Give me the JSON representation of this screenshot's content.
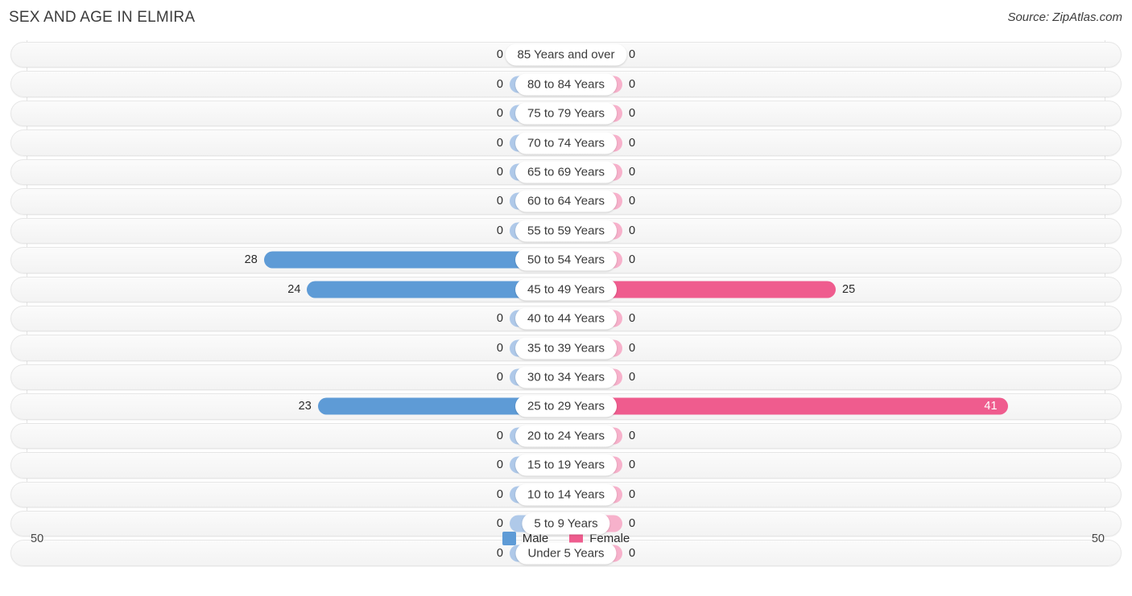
{
  "header": {
    "title": "SEX AND AGE IN ELMIRA",
    "source": "Source: ZipAtlas.com"
  },
  "legend": {
    "male_label": "Male",
    "female_label": "Female",
    "male_color": "#5E9BD6",
    "female_color": "#EF5C8E"
  },
  "axis": {
    "left_max_label": "50",
    "right_max_label": "50"
  },
  "chart_data": {
    "type": "bar",
    "title": "SEX AND AGE IN ELMIRA",
    "subtitle": "Source: ZipAtlas.com",
    "orientation": "horizontal",
    "style": "population-pyramid",
    "xlabel": "",
    "ylabel": "",
    "xlim": [
      -50,
      50
    ],
    "axis_tick_labels": [
      "50",
      "50"
    ],
    "grid": true,
    "legend_position": "bottom-center",
    "categories": [
      "85 Years and over",
      "80 to 84 Years",
      "75 to 79 Years",
      "70 to 74 Years",
      "65 to 69 Years",
      "60 to 64 Years",
      "55 to 59 Years",
      "50 to 54 Years",
      "45 to 49 Years",
      "40 to 44 Years",
      "35 to 39 Years",
      "30 to 34 Years",
      "25 to 29 Years",
      "20 to 24 Years",
      "15 to 19 Years",
      "10 to 14 Years",
      "5 to 9 Years",
      "Under 5 Years"
    ],
    "series": [
      {
        "name": "Male",
        "color": "#5E9BD6",
        "side": "left",
        "values": [
          0,
          0,
          0,
          0,
          0,
          0,
          0,
          28,
          24,
          0,
          0,
          0,
          23,
          0,
          0,
          0,
          0,
          0
        ]
      },
      {
        "name": "Female",
        "color": "#EF5C8E",
        "side": "right",
        "values": [
          0,
          0,
          0,
          0,
          0,
          0,
          0,
          0,
          25,
          0,
          0,
          0,
          41,
          0,
          0,
          0,
          0,
          0
        ]
      }
    ]
  }
}
